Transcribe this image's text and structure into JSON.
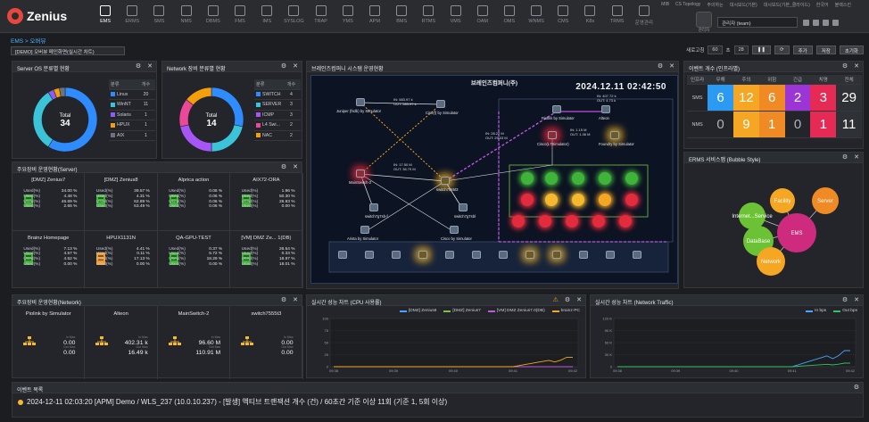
{
  "app": {
    "logo": "Zenius"
  },
  "nav": [
    "EMS",
    "ERMS",
    "SMS",
    "NMS",
    "DBMS",
    "FMS",
    "IMS",
    "SYSLOG",
    "TRAP",
    "YMS",
    "APM",
    "BMS",
    "RTMS",
    "VMS",
    "OAM",
    "OMS",
    "WNMS",
    "CMS",
    "K8s",
    "TRMS",
    "운영관리"
  ],
  "nav_active": 0,
  "toplinks": [
    "MIB",
    "CS Topology",
    "주의하는",
    "대시보드(기본)",
    "대시보드(기본_클라이드)",
    "한국어",
    "블랙스킨"
  ],
  "admin": {
    "label": "관리자",
    "user": "관리자 (team)"
  },
  "breadcrumb": "EMS > 오버뷰",
  "dashboard_select": "[DEMO] 오버뷰 메인화면(실시간 차트)",
  "controls": {
    "refresh_label": "새로고침",
    "refresh_value": "60",
    "unit": "초",
    "interval": "28",
    "add": "추가",
    "save": "저장",
    "reset": "초기화"
  },
  "panels": {
    "server_os": {
      "title": "Server OS 분류별 현황",
      "total_label": "Total",
      "total": "34",
      "col_type": "분류",
      "col_count": "개수",
      "rows": [
        {
          "name": "Linux",
          "count": "20",
          "color": "#2f8cff"
        },
        {
          "name": "WinNT",
          "count": "11",
          "color": "#3bc3d8"
        },
        {
          "name": "Solaris",
          "count": "1",
          "color": "#8b5cf6"
        },
        {
          "name": "HPUX",
          "count": "1",
          "color": "#f59e0b"
        },
        {
          "name": "AIX",
          "count": "1",
          "color": "#6b7280"
        }
      ]
    },
    "network": {
      "title": "Network 장비 분류별 현황",
      "total_label": "Total",
      "total": "14",
      "col_type": "분류",
      "col_count": "개수",
      "rows": [
        {
          "name": "SWITCH",
          "count": "4",
          "color": "#2f8cff"
        },
        {
          "name": "SERVER",
          "count": "3",
          "color": "#3bc3d8"
        },
        {
          "name": "ICMP",
          "count": "3",
          "color": "#a855f7"
        },
        {
          "name": "L4 Swi...",
          "count": "2",
          "color": "#ec4899"
        },
        {
          "name": "NAC",
          "count": "2",
          "color": "#f59e0b"
        }
      ]
    },
    "topology": {
      "title": "브레인즈컴퍼니 시스템 운영현황",
      "map_title": "브레인즈컴퍼니(주)",
      "datetime": "2024.12.11 02:42:50"
    },
    "event_count": {
      "title": "이벤트 개수 (인프라별)",
      "headers": [
        "인프라",
        "무해",
        "주의",
        "위험",
        "긴급",
        "치명",
        "전체"
      ],
      "rows": [
        {
          "infra": "SMS",
          "values": [
            "6",
            "12",
            "6",
            "2",
            "3",
            "29"
          ]
        },
        {
          "infra": "NMS",
          "values": [
            "0",
            "9",
            "1",
            "0",
            "1",
            "11"
          ]
        }
      ]
    },
    "bubble": {
      "title": "ERMS 서비스맵 (Bubble Style)",
      "nodes": [
        "EMS",
        "Facility",
        "Internet...Service",
        "DataBase",
        "Server",
        "Network"
      ]
    },
    "servers": {
      "title": "주요장비 운영현황(Server)",
      "metric_labels": [
        "Used(%)",
        "Used(%)",
        "Used(%)",
        "Used(%)"
      ],
      "items": [
        {
          "name": "[DMZ] Zenius7",
          "color": "green",
          "values": [
            "34.00 %",
            "4.48 %",
            "46.69 %",
            "2.65 %"
          ]
        },
        {
          "name": "[DMZ] Zenius8",
          "color": "green",
          "values": [
            "39.57 %",
            "4.31 %",
            "62.89 %",
            "53.49 %"
          ]
        },
        {
          "name": "Alprica action",
          "color": "green",
          "values": [
            "0.06 %",
            "0.06 %",
            "0.06 %",
            "0.06 %"
          ]
        },
        {
          "name": "AIX72-ORA",
          "color": "green",
          "values": [
            "1.96 %",
            "50.30 %",
            "26.83 %",
            "0.00 %"
          ]
        },
        {
          "name": "Brainz Homepage",
          "color": "green",
          "values": [
            "7.13 %",
            "4.57 %",
            "4.52 %",
            "0.00 %"
          ]
        },
        {
          "name": "HPUX1131N",
          "color": "orange",
          "values": [
            "4.41 %",
            "0.11 %",
            "17.13 %",
            "0.00 %"
          ]
        },
        {
          "name": "QA-GPU-TEST",
          "color": "green",
          "values": [
            "0.37 %",
            "5.72 %",
            "18.29 %",
            "0.00 %"
          ]
        },
        {
          "name": "[VM] DMZ Ze... 1(DB)",
          "color": "green",
          "values": [
            "26.54 %",
            "0.33 %",
            "18.97 %",
            "18.01 %"
          ]
        }
      ]
    },
    "network_ops": {
      "title": "주요장비 운영현황(Network)",
      "in_label": "In Max",
      "out_label": "Out Max",
      "items": [
        {
          "name": "Piolink by Simulator",
          "in": "0.00",
          "out": "0.00"
        },
        {
          "name": "Alteon",
          "in": "402.31 k",
          "out": "16.49 k"
        },
        {
          "name": "MainSwitch-2",
          "in": "96.60 M",
          "out": "110.91 M"
        },
        {
          "name": "switch7555t3",
          "in": "0.00",
          "out": "0.00"
        }
      ]
    },
    "cpu": {
      "title": "실시간 성능 차트 (CPU 사용률)"
    },
    "traffic": {
      "title": "실시간 성능 차트 (Network Traffic)"
    },
    "events": {
      "title": "이벤트 목록",
      "line": "2024-12-11 02:03:20 [APM] Demo / WLS_237 (10.0.10.237) - [발생] 액티브 트랜잭션 개수 (건) / 60초간 기준 이상 11회 (기준 1, 5회 이상)"
    }
  },
  "chart_data": [
    {
      "type": "line",
      "title": "실시간 성능 차트 (CPU 사용률)",
      "x": [
        "09:38",
        "09:39",
        "09:40",
        "09:41",
        "09:42"
      ],
      "ylim": [
        0,
        100
      ],
      "yticks": [
        "100",
        "75",
        "50",
        "25",
        "0"
      ],
      "series": [
        {
          "name": "[DMZ] Zenius8",
          "color": "#4aa3ff",
          "values": [
            0,
            0,
            0,
            0,
            0
          ]
        },
        {
          "name": "[DMZ] Zenius7",
          "color": "#7cc04a",
          "values": [
            0,
            0,
            0,
            0,
            0
          ]
        },
        {
          "name": "[VM] DMZ Zenius7.0(DB)",
          "color": "#c05bd8",
          "values": [
            0,
            0,
            0,
            0,
            0
          ]
        },
        {
          "name": "brainz-PC",
          "color": "#f5a623",
          "values": [
            0,
            0,
            0,
            0,
            22
          ]
        }
      ]
    },
    {
      "type": "line",
      "title": "실시간 성능 차트 (Network Traffic)",
      "x": [
        "09:38",
        "09:39",
        "09:40",
        "09:41",
        "09:42"
      ],
      "ylim": [
        0,
        120
      ],
      "yticks": [
        "120 K",
        "90 K",
        "60 K",
        "30 K",
        "0"
      ],
      "series": [
        {
          "name": "In bps",
          "color": "#4aa3ff",
          "values": [
            0,
            0,
            0,
            0,
            45
          ]
        },
        {
          "name": "Out bps",
          "color": "#37c25a",
          "values": [
            0,
            0,
            0,
            0,
            10
          ]
        }
      ]
    }
  ]
}
